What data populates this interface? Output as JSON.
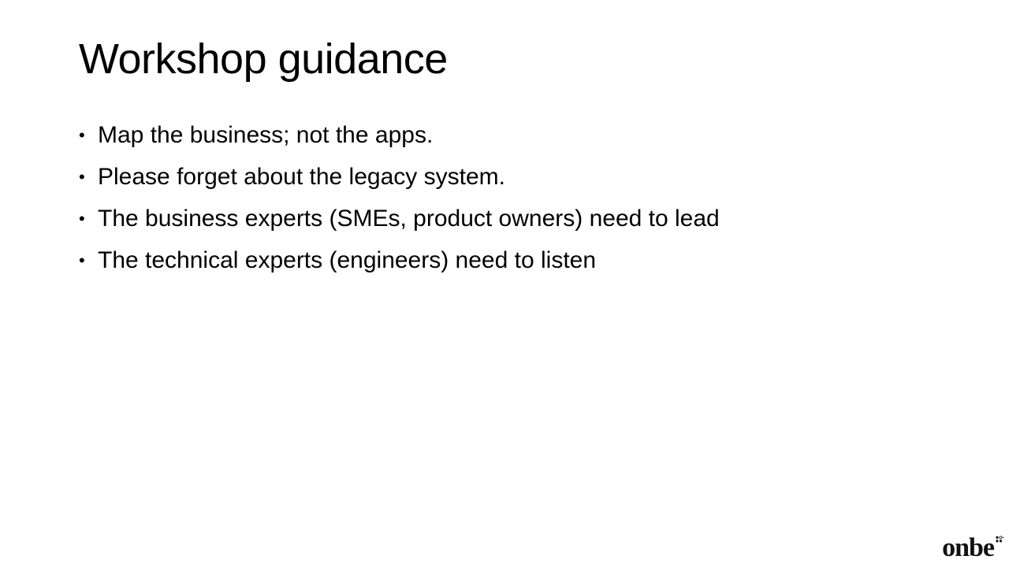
{
  "slide": {
    "title": "Workshop guidance",
    "bullet_symbol": "•",
    "bullets": [
      "Map the business;  not the apps.",
      "Please forget about the legacy system.",
      "The business  experts (SMEs, product owners) need to lead",
      "The technical experts (engineers)  need to listen"
    ]
  },
  "logo": {
    "text": "onbe",
    "icon": "onbe-dots-mark"
  }
}
